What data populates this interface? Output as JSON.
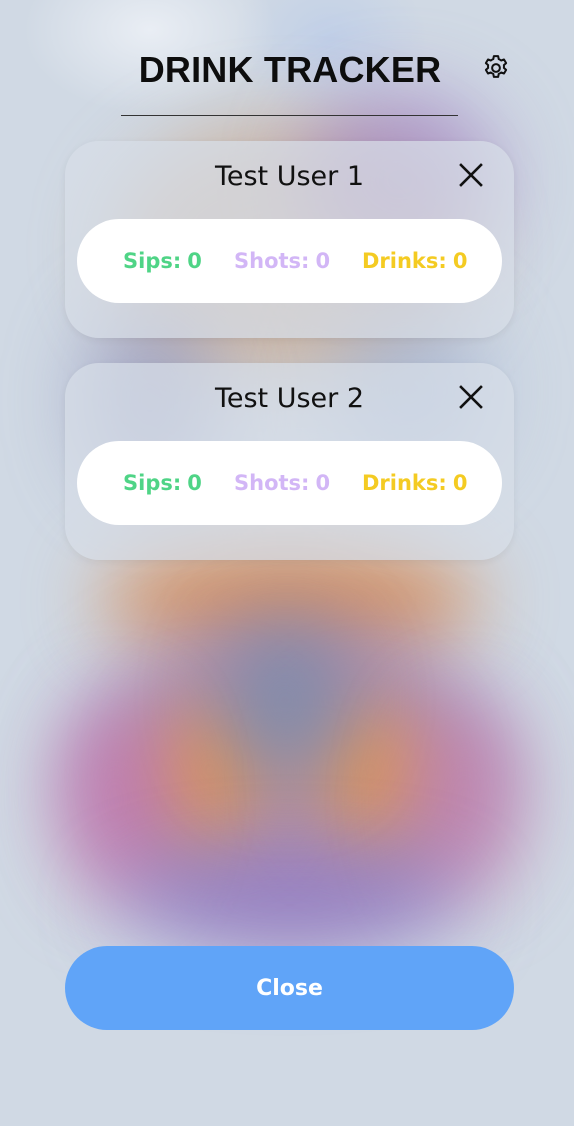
{
  "header": {
    "title": "DRINK TRACKER",
    "settings_icon": "gear-icon"
  },
  "users": [
    {
      "name": "Test User 1",
      "remove_icon": "close-icon",
      "stats": {
        "sips_label": "Sips:",
        "sips_value": "0",
        "shots_label": "Shots:",
        "shots_value": "0",
        "drinks_label": "Drinks:",
        "drinks_value": "0"
      }
    },
    {
      "name": "Test User 2",
      "remove_icon": "close-icon",
      "stats": {
        "sips_label": "Sips:",
        "sips_value": "0",
        "shots_label": "Shots:",
        "shots_value": "0",
        "drinks_label": "Drinks:",
        "drinks_value": "0"
      }
    }
  ],
  "footer": {
    "close_label": "Close"
  },
  "colors": {
    "sips": "#4fd486",
    "shots": "#d2b6f6",
    "drinks": "#f4cb22",
    "close_button": "#60a4f8"
  }
}
